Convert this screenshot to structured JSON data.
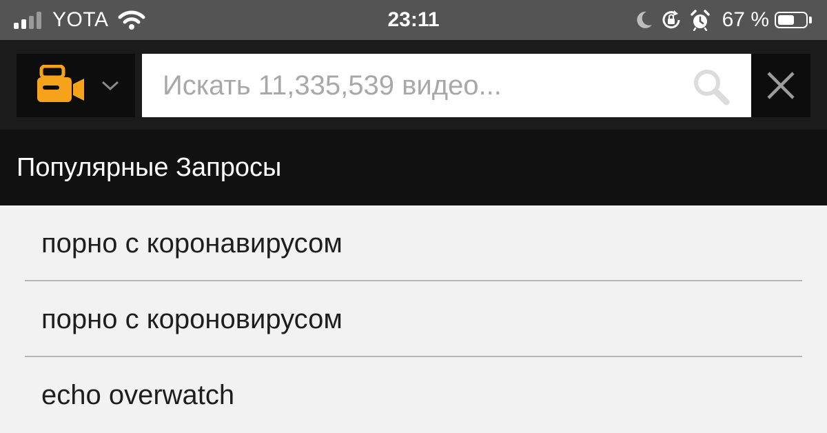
{
  "status_bar": {
    "carrier": "YOTA",
    "time": "23:11",
    "battery_percent": "67 %",
    "battery_level": 0.67,
    "icons": [
      "signal-icon",
      "wifi-icon",
      "moon-icon",
      "rotation-lock-icon",
      "alarm-icon",
      "battery-icon"
    ]
  },
  "header": {
    "category_icon": "video-camera-icon",
    "search": {
      "value": "",
      "placeholder": "Искать 11,335,539 видео..."
    },
    "icons": [
      "chevron-down-icon",
      "search-icon",
      "close-icon"
    ]
  },
  "popular": {
    "title": "Популярные Запросы",
    "items": [
      "порно с коронавирусом",
      "порно с короновирусом",
      "echo overwatch"
    ]
  },
  "colors": {
    "status_bg": "#545454",
    "header_bg": "#1b1b1b",
    "accent": "#f7a21b",
    "list_bg": "#f2f2f2"
  }
}
